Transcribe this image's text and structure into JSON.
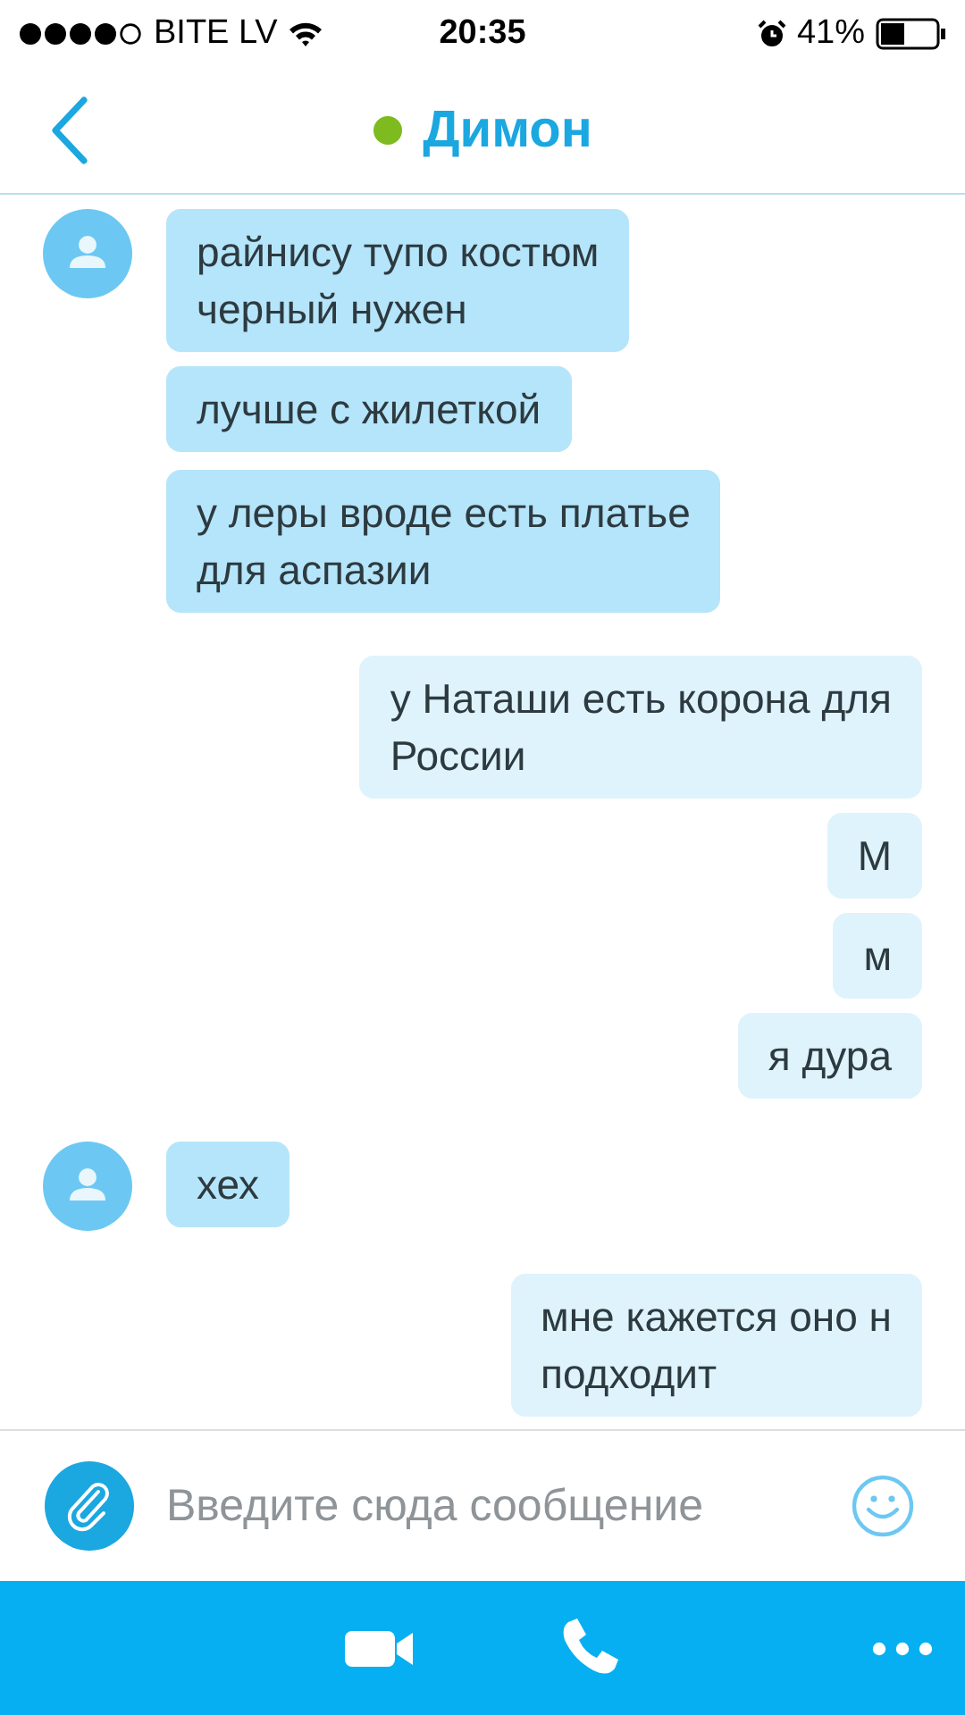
{
  "status_bar": {
    "carrier": "BITE LV",
    "time": "20:35",
    "battery": "41%",
    "alarm": true
  },
  "header": {
    "title": "Димон",
    "online": true
  },
  "messages": [
    {
      "kind": "incoming",
      "avatar": true,
      "text": "райнису тупо костюм\nчерный нужен"
    },
    {
      "kind": "incoming",
      "avatar": false,
      "text": "лучше с жилеткой"
    },
    {
      "kind": "incoming",
      "avatar": false,
      "text": "у леры вроде есть платье\nдля аспазии"
    },
    {
      "kind": "outgoing",
      "avatar": false,
      "text": "у Наташи есть корона для\nРоссии"
    },
    {
      "kind": "outgoing",
      "avatar": false,
      "text": "М"
    },
    {
      "kind": "outgoing",
      "avatar": false,
      "text": "м"
    },
    {
      "kind": "outgoing",
      "avatar": false,
      "text": "я дура"
    },
    {
      "kind": "incoming",
      "avatar": true,
      "text": "хех"
    },
    {
      "kind": "outgoing",
      "avatar": false,
      "text": "мне кажется оно н\nподходит"
    }
  ],
  "composer": {
    "placeholder": "Введите сюда сообщение"
  }
}
